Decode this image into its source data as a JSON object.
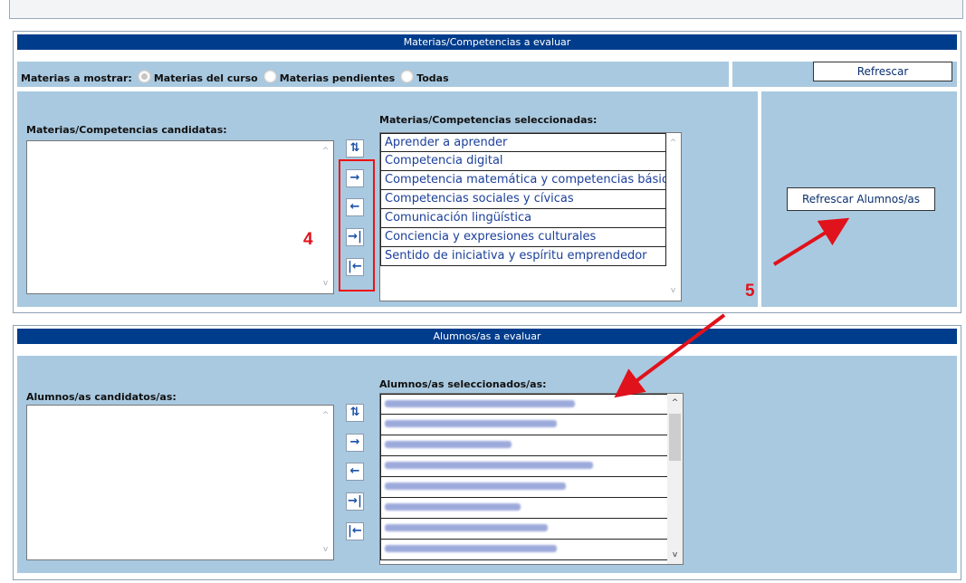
{
  "materias_panel": {
    "title": "Materias/Competencias a evaluar",
    "mostrar_label": "Materias a mostrar:",
    "options": [
      "Materias del curso",
      "Materias pendientes",
      "Todas"
    ],
    "refrescar_label": "Refrescar",
    "candidatas_label": "Materias/Competencias candidatas:",
    "seleccionadas_label": "Materias/Competencias seleccionadas:",
    "selected_items": [
      "Aprender a aprender",
      "Competencia digital",
      "Competencia matemática y competencias básicas en ciencia y tecnología",
      "Competencias sociales y cívicas",
      "Comunicación lingüística",
      "Conciencia y expresiones culturales",
      "Sentido de iniciativa y espíritu emprendedor"
    ],
    "refrescar_alumnos_label": "Refrescar Alumnos/as"
  },
  "alumnos_panel": {
    "title": "Alumnos/as a evaluar",
    "candidatos_label": "Alumnos/as candidatos/as:",
    "seleccionados_label": "Alumnos/as seleccionados/as:",
    "blurred_rows": 8
  },
  "annotations": {
    "step4": "4",
    "step5": "5",
    "color": "#e0121b"
  },
  "icons": {
    "refresh": "refresh-icon",
    "move_right": "arrow-right-icon",
    "move_left": "arrow-left-icon",
    "move_all_right": "arrow-right-bar-icon",
    "move_all_left": "arrow-left-bar-icon"
  }
}
